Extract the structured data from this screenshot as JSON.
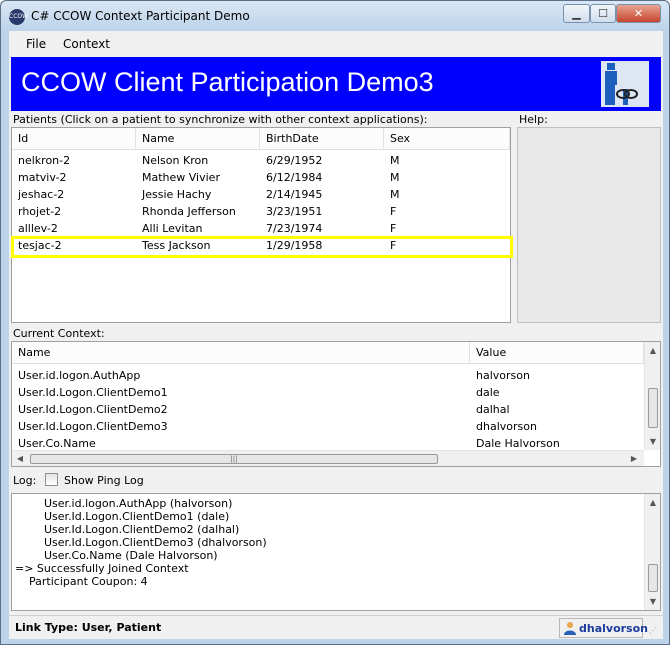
{
  "window": {
    "title": "C# CCOW Context Participant Demo",
    "app_icon_text": "CCOW",
    "min_glyph": "▁",
    "max_glyph": "☐",
    "close_glyph": "✕"
  },
  "menu": {
    "file": "File",
    "context": "Context"
  },
  "banner": {
    "title": "CCOW Client Participation Demo3"
  },
  "patients": {
    "label": "Patients (Click on a patient to synchronize with other context applications):",
    "columns": [
      "Id",
      "Name",
      "BirthDate",
      "Sex"
    ],
    "rows": [
      [
        "nelkron-2",
        "Nelson Kron",
        "6/29/1952",
        "M"
      ],
      [
        "matviv-2",
        "Mathew Vivier",
        "6/12/1984",
        "M"
      ],
      [
        "jeshac-2",
        "Jessie Hachy",
        "2/14/1945",
        "M"
      ],
      [
        "rhojet-2",
        "Rhonda Jefferson",
        "3/23/1951",
        "F"
      ],
      [
        "alllev-2",
        "Alli Levitan",
        "7/23/1974",
        "F"
      ],
      [
        "tesjac-2",
        "Tess Jackson",
        "1/29/1958",
        "F"
      ]
    ],
    "highlight_color": "#ffff00"
  },
  "help": {
    "label": "Help:"
  },
  "context": {
    "label": "Current Context:",
    "columns": [
      "Name",
      "Value"
    ],
    "rows": [
      [
        "User.id.logon.AuthApp",
        "halvorson"
      ],
      [
        "User.Id.Logon.ClientDemo1",
        "dale"
      ],
      [
        "User.Id.Logon.ClientDemo2",
        "dalhal"
      ],
      [
        "User.Id.Logon.ClientDemo3",
        "dhalvorson"
      ],
      [
        "User.Co.Name",
        "Dale Halvorson"
      ]
    ]
  },
  "log": {
    "label": "Log:",
    "show_ping_label": "Show Ping Log",
    "show_ping_checked": false,
    "lines": [
      "User.id.logon.AuthApp (halvorson)",
      "User.Id.Logon.ClientDemo1 (dale)",
      "User.Id.Logon.ClientDemo2 (dalhal)",
      "User.Id.Logon.ClientDemo3 (dhalvorson)",
      "User.Co.Name (Dale Halvorson)",
      "=> Successfully Joined Context",
      "Participant Coupon: 4"
    ]
  },
  "status": {
    "link_type": "Link Type: User, Patient",
    "user": "dhalvorson"
  },
  "icons": {
    "up_arrow": "▲",
    "down_arrow": "▼",
    "left_arrow": "◀",
    "right_arrow": "▶",
    "grip": "⋰"
  }
}
